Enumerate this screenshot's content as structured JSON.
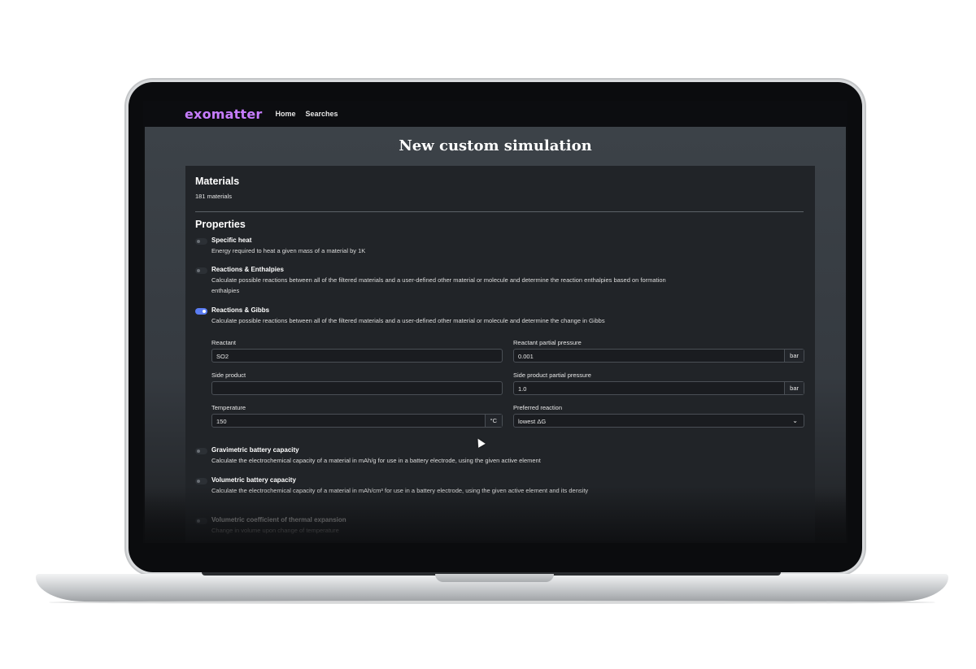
{
  "nav": {
    "logo": "exomatter",
    "links": [
      "Home",
      "Searches"
    ]
  },
  "page": {
    "title": "New custom simulation"
  },
  "materials": {
    "heading": "Materials",
    "count": "181 materials"
  },
  "properties": {
    "heading": "Properties",
    "items": [
      {
        "title": "Specific heat",
        "desc": "Energy required to heat a given mass of a material by 1K",
        "enabled": false
      },
      {
        "title": "Reactions & Enthalpies",
        "desc": "Calculate possible reactions between all of the filtered materials and a user-defined other material or molecule and determine the reaction enthalpies based on formation enthalpies",
        "enabled": false
      },
      {
        "title": "Reactions & Gibbs",
        "desc": "Calculate possible reactions between all of the filtered materials and a user-defined other material or molecule and determine the change in Gibbs",
        "enabled": true
      },
      {
        "title": "Gravimetric battery capacity",
        "desc": "Calculate the electrochemical capacity of a material in mAh/g for use in a battery electrode, using the given active element",
        "enabled": false
      },
      {
        "title": "Volumetric battery capacity",
        "desc": "Calculate the electrochemical capacity of a material in mAh/cm³ for use in a battery electrode, using the given active element and its density",
        "enabled": false
      },
      {
        "title": "Volumetric coefficient of thermal expansion",
        "desc": "Change in volume upon change of temperature",
        "enabled": false
      }
    ]
  },
  "gibbs_form": {
    "reactant_label": "Reactant",
    "reactant_value": "SO2",
    "reactant_pp_label": "Reactant partial pressure",
    "reactant_pp_value": "0.001",
    "reactant_pp_unit": "bar",
    "side_product_label": "Side product",
    "side_product_value": "",
    "side_pp_label": "Side product partial pressure",
    "side_pp_value": "1.0",
    "side_pp_unit": "bar",
    "temperature_label": "Temperature",
    "temperature_value": "150",
    "temperature_unit": "°C",
    "preferred_label": "Preferred reaction",
    "preferred_value": "lowest ΔG"
  },
  "colors": {
    "accent": "#5a7cf2",
    "logo": "#c77dff"
  }
}
